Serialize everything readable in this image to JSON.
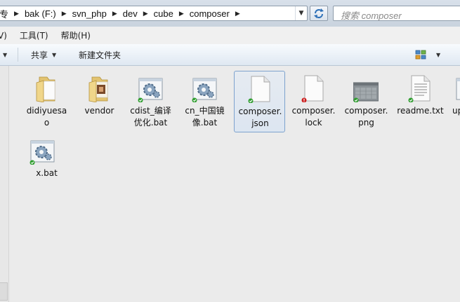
{
  "address": {
    "crumbs": [
      "专",
      "bak (F:)",
      "svn_php",
      "dev",
      "cube",
      "composer"
    ]
  },
  "search": {
    "placeholder": "搜索 composer"
  },
  "menu": {
    "items": [
      "V)",
      "工具(T)",
      "帮助(H)"
    ]
  },
  "toolbar": {
    "share_label": "共享",
    "new_folder_label": "新建文件夹"
  },
  "files": [
    {
      "name": "didiyuesa\no",
      "icon": "folder-icon",
      "status": "none"
    },
    {
      "name": "vendor",
      "icon": "folder-icon",
      "status": "none"
    },
    {
      "name": "cdist_编译\n优化.bat",
      "icon": "batch-file-icon",
      "status": "ok"
    },
    {
      "name": "cn_中国镜\n像.bat",
      "icon": "batch-file-icon",
      "status": "ok"
    },
    {
      "name": "composer.\njson",
      "icon": "blank-file-icon",
      "status": "ok",
      "selected": true
    },
    {
      "name": "composer.\nlock",
      "icon": "blank-file-icon",
      "status": "modified"
    },
    {
      "name": "composer.\npng",
      "icon": "image-file-icon",
      "status": "ok"
    },
    {
      "name": "readme.txt",
      "icon": "text-file-icon",
      "status": "ok"
    },
    {
      "name": "up",
      "icon": "batch-file-icon",
      "status": "none"
    },
    {
      "name": "x.bat",
      "icon": "batch-file-icon",
      "status": "ok"
    }
  ],
  "colors": {
    "ok_overlay": "#2f9e2f",
    "modified_overlay": "#cc1f1f",
    "selection_border": "#7da2ce"
  }
}
